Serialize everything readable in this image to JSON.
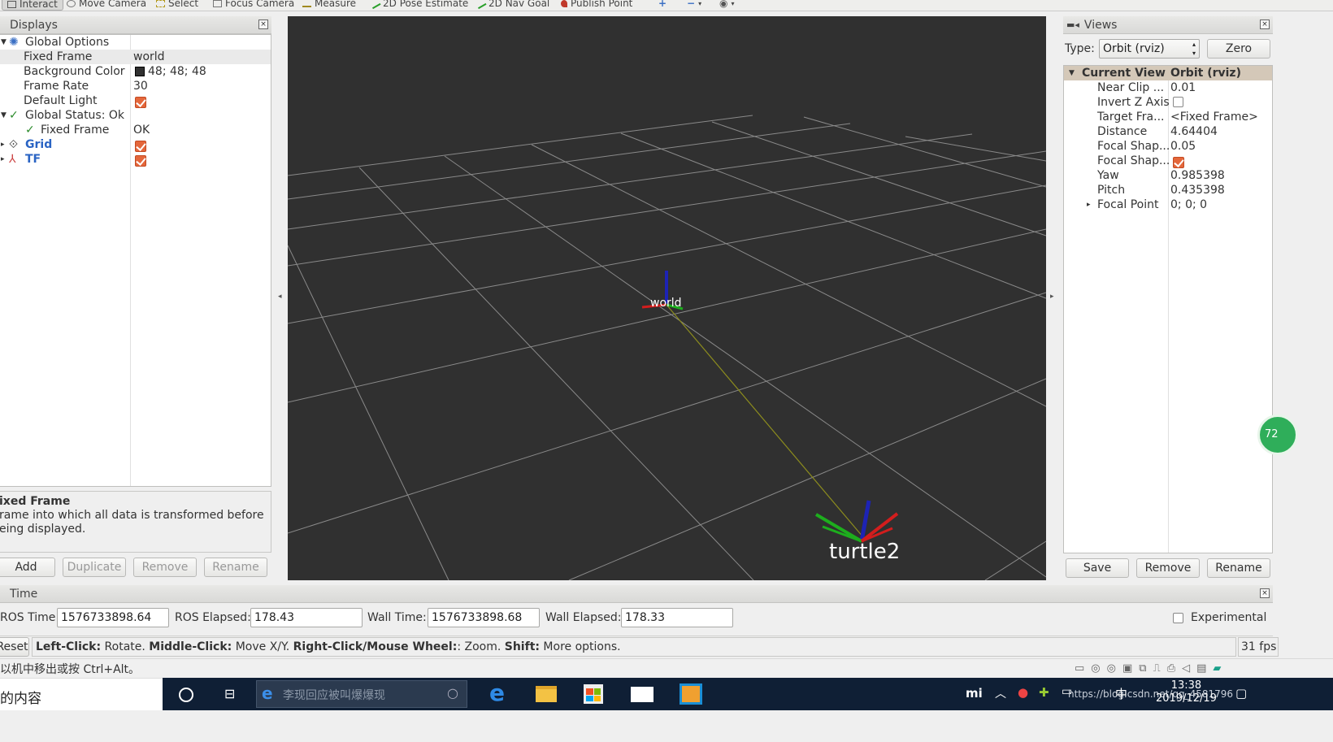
{
  "toolbar": {
    "tools": [
      "Interact",
      "Move Camera",
      "Select",
      "Focus Camera",
      "Measure",
      "2D Pose Estimate",
      "2D Nav Goal",
      "Publish Point"
    ]
  },
  "displays": {
    "title": "Displays",
    "rows": {
      "global_options": "Global Options",
      "fixed_frame_label": "Fixed Frame",
      "fixed_frame_value": "world",
      "bg_color_label": "Background Color",
      "bg_color_value": "48; 48; 48",
      "frame_rate_label": "Frame Rate",
      "frame_rate_value": "30",
      "default_light_label": "Default Light",
      "global_status_label": "Global Status: Ok",
      "status_fixed_frame_label": "Fixed Frame",
      "status_fixed_frame_value": "OK",
      "grid_label": "Grid",
      "tf_label": "TF"
    },
    "description": {
      "title": "ixed Frame",
      "line1": "rame into which all data is transformed before",
      "line2": "eing displayed."
    },
    "buttons": {
      "add": "Add",
      "duplicate": "Duplicate",
      "remove": "Remove",
      "rename": "Rename"
    }
  },
  "viewport": {
    "frame_world": "world",
    "frame_turtle": "turtle2",
    "bg_color": "#303030"
  },
  "views": {
    "title": "Views",
    "type_label": "Type:",
    "type_value": "Orbit (rviz)",
    "zero": "Zero",
    "header_col1": "Current View",
    "header_col2": "Orbit (rviz)",
    "props": [
      {
        "name": "Near Clip ...",
        "value": "0.01"
      },
      {
        "name": "Invert Z Axis",
        "value": ""
      },
      {
        "name": "Target Fra...",
        "value": "<Fixed Frame>"
      },
      {
        "name": "Distance",
        "value": "4.64404"
      },
      {
        "name": "Focal Shap...",
        "value": "0.05"
      },
      {
        "name": "Focal Shap...",
        "value": ""
      },
      {
        "name": "Yaw",
        "value": "0.985398"
      },
      {
        "name": "Pitch",
        "value": "0.435398"
      },
      {
        "name": "Focal Point",
        "value": "0; 0; 0"
      }
    ],
    "buttons": {
      "save": "Save",
      "remove": "Remove",
      "rename": "Rename"
    }
  },
  "time": {
    "title": "Time",
    "ros_time_label": "ROS Time:",
    "ros_time_value": "1576733898.64",
    "ros_elapsed_label": "ROS Elapsed:",
    "ros_elapsed_value": "178.43",
    "wall_time_label": "Wall Time:",
    "wall_time_value": "1576733898.68",
    "wall_elapsed_label": "Wall Elapsed:",
    "wall_elapsed_value": "178.33",
    "experimental": "Experimental"
  },
  "statusbar": {
    "reset": "Reset",
    "help_b1": "Left-Click:",
    "help_t1": " Rotate. ",
    "help_b2": "Middle-Click:",
    "help_t2": " Move X/Y. ",
    "help_b3": "Right-Click/Mouse Wheel:",
    "help_t3": ": Zoom. ",
    "help_b4": "Shift:",
    "help_t4": " More options.",
    "fps": "31 fps"
  },
  "vm_hint": "以机中移出或按 Ctrl+Alt。",
  "side_badge": "72",
  "taskbar": {
    "left_text": "的内容",
    "search_placeholder": "李现回应被叫爆爆现",
    "time": "13:38",
    "date": "2019/12/19",
    "watermark": "https://blog.csdn.net/qq_4581796",
    "ime": "中"
  }
}
